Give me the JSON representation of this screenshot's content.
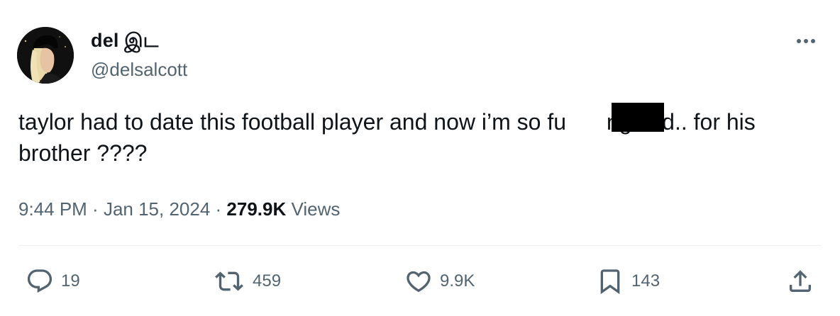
{
  "author": {
    "display_name": "del இட",
    "handle": "@delsalcott",
    "avatar_icon": "profile-photo"
  },
  "tweet": {
    "text": "taylor had to date this football player and now i’m so fu    ng sad.. for his\nbrother ????",
    "redacted": true
  },
  "meta": {
    "time": "9:44 PM",
    "sep1": " · ",
    "date": "Jan 15, 2024",
    "sep2": " · ",
    "views_count": "279.9K",
    "views_label": " Views"
  },
  "actions": {
    "reply": {
      "icon": "reply-icon",
      "count": "19"
    },
    "repost": {
      "icon": "repost-icon",
      "count": "459"
    },
    "like": {
      "icon": "heart-icon",
      "count": "9.9K"
    },
    "bookmark": {
      "icon": "bookmark-icon",
      "count": "143"
    },
    "share": {
      "icon": "share-icon"
    }
  },
  "colors": {
    "text_primary": "#0f1419",
    "text_secondary": "#536471",
    "divider": "#eff3f4"
  }
}
